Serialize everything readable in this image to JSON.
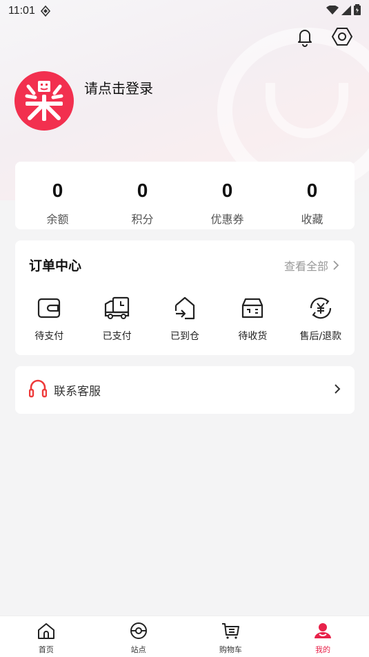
{
  "status_bar": {
    "time": "11:01"
  },
  "profile": {
    "login_prompt": "请点击登录",
    "avatar_glyph": "樂",
    "brand_color": "#f2304f"
  },
  "stats": [
    {
      "value": "0",
      "label": "余额"
    },
    {
      "value": "0",
      "label": "积分"
    },
    {
      "value": "0",
      "label": "优惠券"
    },
    {
      "value": "0",
      "label": "收藏"
    }
  ],
  "orders": {
    "title": "订单中心",
    "view_all": "查看全部",
    "items": [
      {
        "label": "待支付",
        "icon": "wallet-icon"
      },
      {
        "label": "已支付",
        "icon": "truck-clock-icon"
      },
      {
        "label": "已到仓",
        "icon": "warehouse-icon"
      },
      {
        "label": "待收货",
        "icon": "box-icon"
      },
      {
        "label": "售后/退款",
        "icon": "yen-refund-icon"
      }
    ]
  },
  "service": {
    "label": "联系客服",
    "icon": "headset-icon",
    "icon_color": "#ee3a3a"
  },
  "tabbar": {
    "accent": "#e8224a",
    "items": [
      {
        "label": "首页",
        "icon": "home-icon"
      },
      {
        "label": "站点",
        "icon": "station-icon"
      },
      {
        "label": "购物车",
        "icon": "cart-icon"
      },
      {
        "label": "我的",
        "icon": "user-icon",
        "active": true
      }
    ]
  }
}
